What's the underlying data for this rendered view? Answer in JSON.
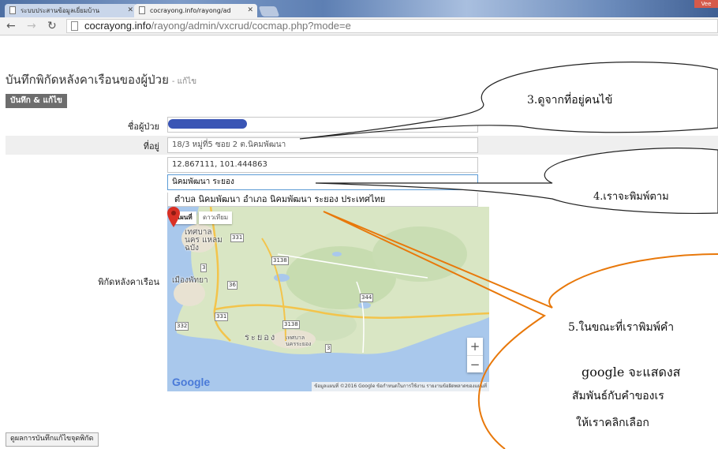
{
  "browser": {
    "tabs": [
      {
        "label": "ระบบประสานข้อมูลเยี่ยมบ้าน",
        "active": false
      },
      {
        "label": "cocrayong.info/rayong/ad",
        "active": true
      }
    ],
    "window_badge": "Vee",
    "url_host": "cocrayong.info",
    "url_path": "/rayong/admin/vxcrud/cocmap.php?mode=e"
  },
  "page": {
    "title": "บันทึกพิกัดหลังคาเรือนของผู้ป่วย",
    "title_sub": "- แก้ไข",
    "save_button": "บันทึก & แก้ไข",
    "form": {
      "name_label": "ชื่อผู้ป่วย",
      "address_label": "ที่อยู่",
      "address_value": "18/3 หมู่ที่5 ซอย 2 ต.นิคมพัฒนา",
      "latlng_value": "12.867111, 101.444863",
      "search_value": "นิคมพัฒนา ระยอง",
      "suggestion": "ตำบล นิคมพัฒนา อำเภอ นิคมพัฒนา ระยอง ประเทศไทย",
      "coord_label": "พิกัดหลังคาเรือน"
    },
    "map": {
      "type_map": "แผนที่",
      "type_satellite": "ดาวเทียม",
      "places": [
        "เทศบาลนคร แหลมฉบัง",
        "เมืองพัทยา",
        "ระยอง",
        "เทศบาล นครระยอง"
      ],
      "roads": [
        "331",
        "3138",
        "3",
        "36",
        "344",
        "331",
        "332",
        "3138",
        "3"
      ],
      "zoom_in": "+",
      "zoom_out": "−",
      "logo": "Google",
      "footer": "ข้อมูลแผนที่ ©2016 Google   ข้อกำหนดในการใช้งาน   รายงานข้อผิดพลาดของแผนที่"
    },
    "result_button": "ดูผลการบันทึกแก้ไขจุดพิกัด"
  },
  "callouts": {
    "c3": "3.ดูจากที่อยู่คนไข้",
    "c4": "4.เราจะพิมพ์ตาม",
    "c5_line1": "5.ในขณะที่เราพิมพ์คำ",
    "c5_line2": "google จะแสดงส",
    "c5_line3": "สัมพันธ์กับคำของเร",
    "c5_line4": "ให้เราคลิกเลือก"
  },
  "colors": {
    "redact": "#3a55b5",
    "pin": "#d93025",
    "save_button_bg": "#6d6d6d"
  }
}
